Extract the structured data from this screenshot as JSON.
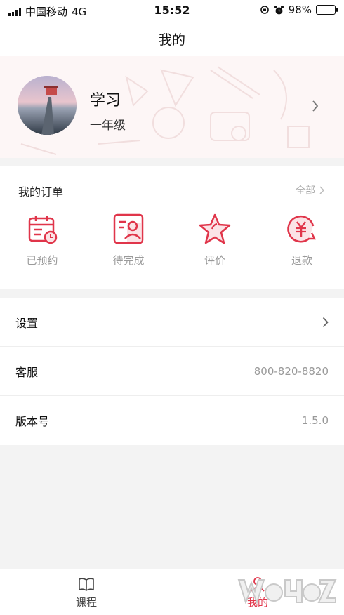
{
  "status_bar": {
    "carrier": "中国移动",
    "network": "4G",
    "time": "15:52",
    "battery": "98%",
    "battery_level": 0.98
  },
  "nav": {
    "title": "我的"
  },
  "profile": {
    "name": "学习",
    "grade": "一年级"
  },
  "orders": {
    "title": "我的订单",
    "all_label": "全部",
    "items": [
      {
        "label": "已预约",
        "icon": "calendar-clock-icon"
      },
      {
        "label": "待完成",
        "icon": "person-card-icon"
      },
      {
        "label": "评价",
        "icon": "star-icon"
      },
      {
        "label": "退款",
        "icon": "yen-refund-icon"
      }
    ]
  },
  "menu": {
    "settings": {
      "label": "设置"
    },
    "service": {
      "label": "客服",
      "value": "800-820-8820"
    },
    "version": {
      "label": "版本号",
      "value": "1.5.0"
    }
  },
  "tabs": [
    {
      "label": "课程",
      "icon": "book-icon",
      "active": false
    },
    {
      "label": "我的",
      "icon": "person-icon",
      "active": true
    }
  ],
  "colors": {
    "accent": "#e0354a",
    "muted_text": "#999999",
    "background": "#f3f3f3"
  }
}
